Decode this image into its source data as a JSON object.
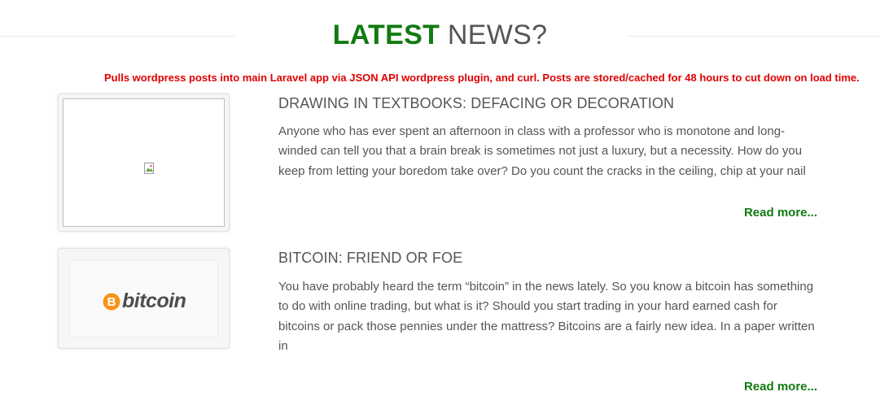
{
  "section": {
    "heading_strong": "LATEST",
    "heading_light": "NEWS?"
  },
  "annotation": "Pulls wordpress posts into main Laravel app via JSON API wordpress plugin, and curl. Posts are stored/cached for 48 hours to cut down on load time.",
  "posts": [
    {
      "title": "DRAWING IN TEXTBOOKS: DEFACING OR DECORATION",
      "excerpt": "Anyone who has ever spent an afternoon in class with a professor who is monotone and long-winded can tell you that a brain break is sometimes not just a luxury, but a necessity. How do you keep from letting your boredom take over? Do you count the cracks in the ceiling, chip at your nail",
      "read_more": "Read more...",
      "thumbnail_icon": "broken-image-icon"
    },
    {
      "title": "BITCOIN: FRIEND OR FOE",
      "excerpt": "You have probably heard the term “bitcoin” in the news lately. So you know a bitcoin has something to do with online trading, but what is it? Should you start trading in your hard earned cash for bitcoins or pack those pennies under the mattress? Bitcoins are a fairly new idea. In a paper written in",
      "read_more": "Read more...",
      "thumbnail_logo_text": "bitcoin"
    }
  ],
  "colors": {
    "accent_green": "#117a11",
    "annotation_red": "#e00000",
    "text_gray": "#555555",
    "bitcoin_orange": "#f7931a"
  }
}
